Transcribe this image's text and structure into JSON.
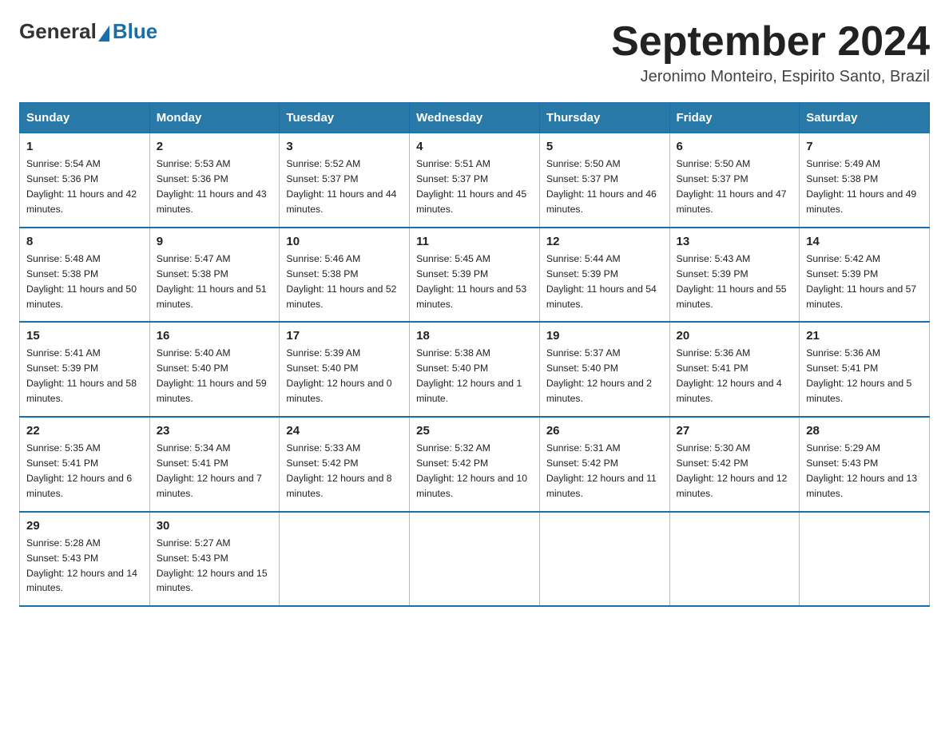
{
  "logo": {
    "general": "General",
    "blue": "Blue"
  },
  "title": "September 2024",
  "location": "Jeronimo Monteiro, Espirito Santo, Brazil",
  "weekdays": [
    "Sunday",
    "Monday",
    "Tuesday",
    "Wednesday",
    "Thursday",
    "Friday",
    "Saturday"
  ],
  "weeks": [
    [
      {
        "day": "1",
        "sunrise": "5:54 AM",
        "sunset": "5:36 PM",
        "daylight": "11 hours and 42 minutes."
      },
      {
        "day": "2",
        "sunrise": "5:53 AM",
        "sunset": "5:36 PM",
        "daylight": "11 hours and 43 minutes."
      },
      {
        "day": "3",
        "sunrise": "5:52 AM",
        "sunset": "5:37 PM",
        "daylight": "11 hours and 44 minutes."
      },
      {
        "day": "4",
        "sunrise": "5:51 AM",
        "sunset": "5:37 PM",
        "daylight": "11 hours and 45 minutes."
      },
      {
        "day": "5",
        "sunrise": "5:50 AM",
        "sunset": "5:37 PM",
        "daylight": "11 hours and 46 minutes."
      },
      {
        "day": "6",
        "sunrise": "5:50 AM",
        "sunset": "5:37 PM",
        "daylight": "11 hours and 47 minutes."
      },
      {
        "day": "7",
        "sunrise": "5:49 AM",
        "sunset": "5:38 PM",
        "daylight": "11 hours and 49 minutes."
      }
    ],
    [
      {
        "day": "8",
        "sunrise": "5:48 AM",
        "sunset": "5:38 PM",
        "daylight": "11 hours and 50 minutes."
      },
      {
        "day": "9",
        "sunrise": "5:47 AM",
        "sunset": "5:38 PM",
        "daylight": "11 hours and 51 minutes."
      },
      {
        "day": "10",
        "sunrise": "5:46 AM",
        "sunset": "5:38 PM",
        "daylight": "11 hours and 52 minutes."
      },
      {
        "day": "11",
        "sunrise": "5:45 AM",
        "sunset": "5:39 PM",
        "daylight": "11 hours and 53 minutes."
      },
      {
        "day": "12",
        "sunrise": "5:44 AM",
        "sunset": "5:39 PM",
        "daylight": "11 hours and 54 minutes."
      },
      {
        "day": "13",
        "sunrise": "5:43 AM",
        "sunset": "5:39 PM",
        "daylight": "11 hours and 55 minutes."
      },
      {
        "day": "14",
        "sunrise": "5:42 AM",
        "sunset": "5:39 PM",
        "daylight": "11 hours and 57 minutes."
      }
    ],
    [
      {
        "day": "15",
        "sunrise": "5:41 AM",
        "sunset": "5:39 PM",
        "daylight": "11 hours and 58 minutes."
      },
      {
        "day": "16",
        "sunrise": "5:40 AM",
        "sunset": "5:40 PM",
        "daylight": "11 hours and 59 minutes."
      },
      {
        "day": "17",
        "sunrise": "5:39 AM",
        "sunset": "5:40 PM",
        "daylight": "12 hours and 0 minutes."
      },
      {
        "day": "18",
        "sunrise": "5:38 AM",
        "sunset": "5:40 PM",
        "daylight": "12 hours and 1 minute."
      },
      {
        "day": "19",
        "sunrise": "5:37 AM",
        "sunset": "5:40 PM",
        "daylight": "12 hours and 2 minutes."
      },
      {
        "day": "20",
        "sunrise": "5:36 AM",
        "sunset": "5:41 PM",
        "daylight": "12 hours and 4 minutes."
      },
      {
        "day": "21",
        "sunrise": "5:36 AM",
        "sunset": "5:41 PM",
        "daylight": "12 hours and 5 minutes."
      }
    ],
    [
      {
        "day": "22",
        "sunrise": "5:35 AM",
        "sunset": "5:41 PM",
        "daylight": "12 hours and 6 minutes."
      },
      {
        "day": "23",
        "sunrise": "5:34 AM",
        "sunset": "5:41 PM",
        "daylight": "12 hours and 7 minutes."
      },
      {
        "day": "24",
        "sunrise": "5:33 AM",
        "sunset": "5:42 PM",
        "daylight": "12 hours and 8 minutes."
      },
      {
        "day": "25",
        "sunrise": "5:32 AM",
        "sunset": "5:42 PM",
        "daylight": "12 hours and 10 minutes."
      },
      {
        "day": "26",
        "sunrise": "5:31 AM",
        "sunset": "5:42 PM",
        "daylight": "12 hours and 11 minutes."
      },
      {
        "day": "27",
        "sunrise": "5:30 AM",
        "sunset": "5:42 PM",
        "daylight": "12 hours and 12 minutes."
      },
      {
        "day": "28",
        "sunrise": "5:29 AM",
        "sunset": "5:43 PM",
        "daylight": "12 hours and 13 minutes."
      }
    ],
    [
      {
        "day": "29",
        "sunrise": "5:28 AM",
        "sunset": "5:43 PM",
        "daylight": "12 hours and 14 minutes."
      },
      {
        "day": "30",
        "sunrise": "5:27 AM",
        "sunset": "5:43 PM",
        "daylight": "12 hours and 15 minutes."
      },
      null,
      null,
      null,
      null,
      null
    ]
  ],
  "labels": {
    "sunrise": "Sunrise:",
    "sunset": "Sunset:",
    "daylight": "Daylight:"
  }
}
